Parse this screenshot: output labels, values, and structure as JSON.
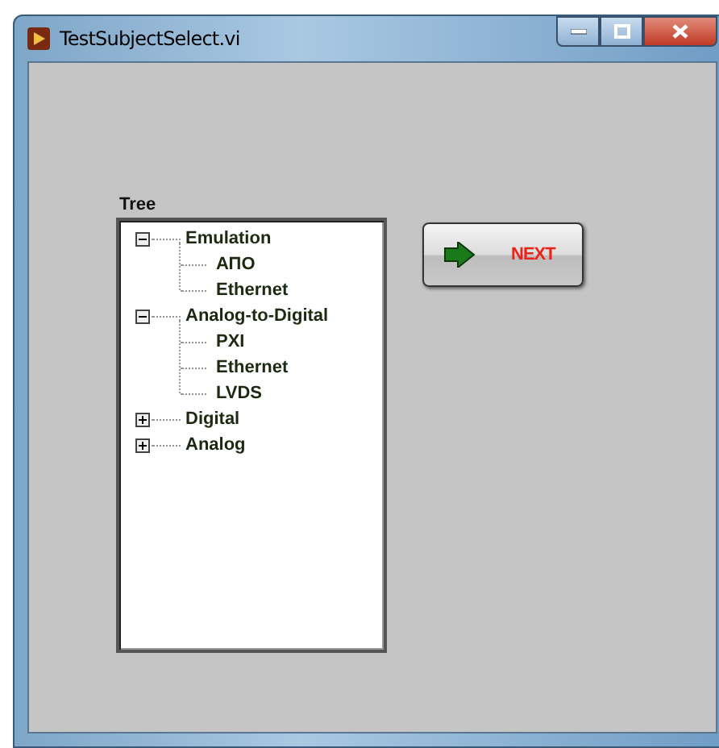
{
  "window": {
    "title": "TestSubjectSelect.vi"
  },
  "tree": {
    "label": "Tree",
    "items": [
      {
        "label": "Emulation",
        "expanded": true,
        "children": [
          {
            "label": "АПО"
          },
          {
            "label": "Ethernet"
          }
        ]
      },
      {
        "label": "Analog-to-Digital",
        "expanded": true,
        "children": [
          {
            "label": "PXI"
          },
          {
            "label": "Ethernet"
          },
          {
            "label": "LVDS"
          }
        ]
      },
      {
        "label": "Digital",
        "expanded": false
      },
      {
        "label": "Analog",
        "expanded": false
      }
    ]
  },
  "next_button": {
    "label": "NEXT"
  }
}
